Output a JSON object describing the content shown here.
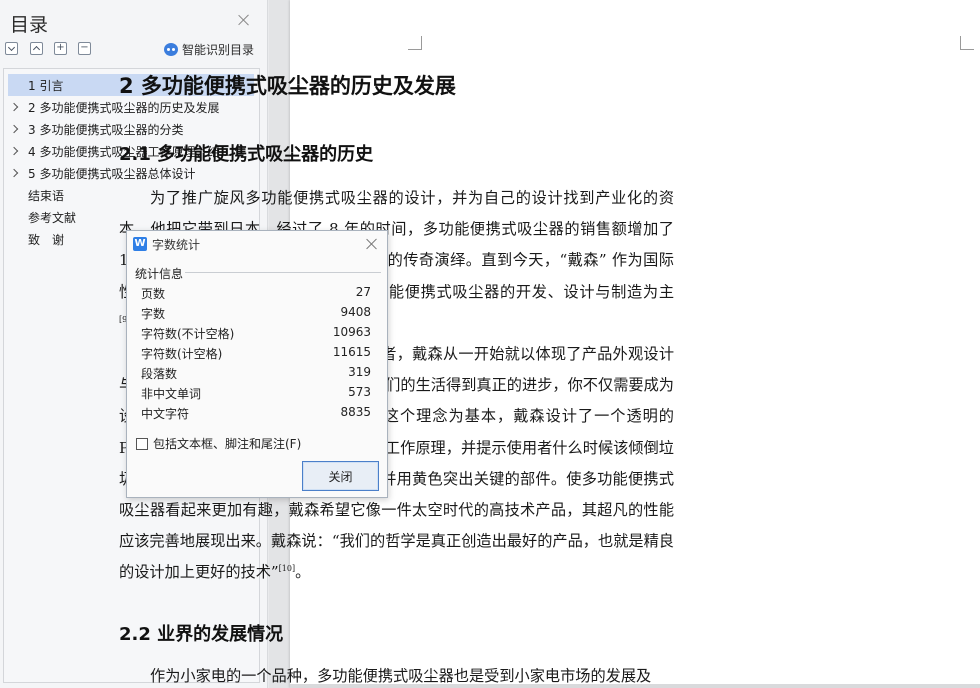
{
  "toc": {
    "title": "目录",
    "smart_toc_label": "智能识别目录",
    "tools": {
      "expand_symbol": "+",
      "collapse_symbol": "−"
    },
    "items": [
      {
        "label": "1  引言",
        "has_children": false,
        "selected": true
      },
      {
        "label": "2  多功能便携式吸尘器的历史及发展",
        "has_children": true,
        "selected": false
      },
      {
        "label": "3  多功能便携式吸尘器的分类",
        "has_children": true,
        "selected": false
      },
      {
        "label": "4  多功能便携式吸尘器工作原理、结...",
        "has_children": true,
        "selected": false
      },
      {
        "label": "5  多功能便携式吸尘器总体设计",
        "has_children": true,
        "selected": false
      },
      {
        "label": "结束语",
        "has_children": false,
        "selected": false
      },
      {
        "label": "参考文献",
        "has_children": false,
        "selected": false
      },
      {
        "label": "致　谢",
        "has_children": false,
        "selected": false
      }
    ]
  },
  "word_count_dialog": {
    "logo": "W",
    "title": "字数统计",
    "group_label": "统计信息",
    "stats": [
      {
        "label": "页数",
        "value": "27"
      },
      {
        "label": "字数",
        "value": "9408"
      },
      {
        "label": "字符数(不计空格)",
        "value": "10963"
      },
      {
        "label": "字符数(计空格)",
        "value": "11615"
      },
      {
        "label": "段落数",
        "value": "319"
      },
      {
        "label": "非中文单词",
        "value": "573"
      },
      {
        "label": "中文字符",
        "value": "8835"
      }
    ],
    "checkbox_label": "包括文本框、脚注和尾注(F)",
    "checkbox_checked": false,
    "close_button": "关闭"
  },
  "document": {
    "chapter_heading": "2  多功能便携式吸尘器的历史及发展",
    "section1_heading": "2.1  多功能便携式吸尘器的历史",
    "para1_text": "为了推广旋风多功能便携式吸尘器的设计，并为自己的设计找到产业化的资本，他把它带到日本。经过了 8 年的时间，多功能便携式吸尘器的销售额增加了 100 倍。开始了多功能便携式吸尘器界的传奇演绎。直到今天，“戴森” 作为国际性的家电设计制造公司，仍然是以多功能便携式吸尘器的开发、设计与制造为主",
    "para1_cite": "[9]",
    "para1_end": "。",
    "para2_text": "作为多功能便携式吸尘器界的领军者，戴森从一开始就以体现了产品外观设计与工程技术的完美结合为目的——“让我们的生活得到真正的进步，你不仅需要成为设计师，还需要成为一个工程师。” 以这个理念为基本，戴森设计了一个透明的 PVC 外箱以显示多功能便携式吸尘器的工作原理，并提示使用者什么时候该倾倒垃圾。第一款样品是采用了银色的机身，并用黄色突出关键的部件。使多功能便携式吸尘器看起来更加有趣，戴森希望它像一件太空时代的高技术产品，其超凡的性能应该完善地展现出来。戴森说：“我们的哲学是真正创造出最好的产品，也就是精良的设计加上更好的技术”",
    "para2_cite": "[10]",
    "para2_end": "。",
    "section2_heading": "2.2  业界的发展情况",
    "para3_text": "作为小家电的一个品种，多功能便携式吸尘器也是受到小家电市场的发展及"
  }
}
